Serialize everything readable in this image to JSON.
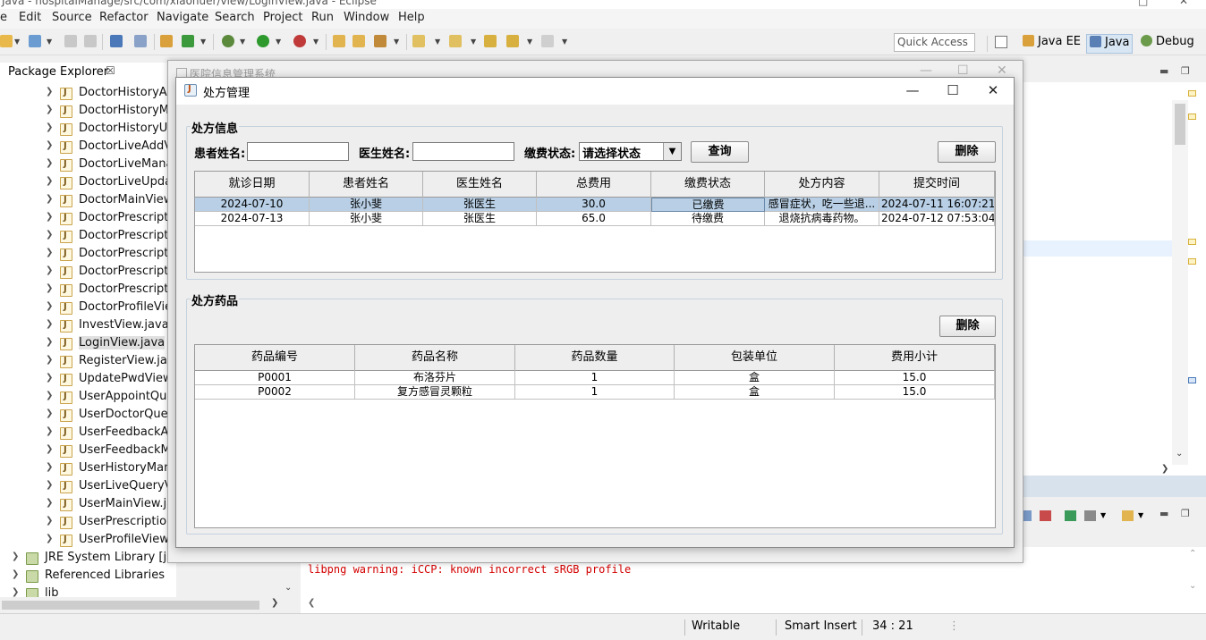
{
  "eclipse": {
    "window_title": "Java - hospitalManage/src/com/xiaohuer/view/LoginView.java - Eclipse",
    "menu": [
      "e",
      "Edit",
      "Source",
      "Refactor",
      "Navigate",
      "Search",
      "Project",
      "Run",
      "Window",
      "Help"
    ],
    "quick_access_placeholder": "Quick Access",
    "perspectives": [
      {
        "label": "Java EE"
      },
      {
        "label": "Java"
      },
      {
        "label": "Debug"
      }
    ],
    "package_explorer": {
      "tab_label": "Package Explorer",
      "tab_close": "☒",
      "files": [
        "DoctorHistoryAdd",
        "DoctorHistoryMa",
        "DoctorHistoryUpc",
        "DoctorLiveAddVie",
        "DoctorLiveManag",
        "DoctorLiveUpdate",
        "DoctorMainView.j",
        "DoctorPrescriptio",
        "DoctorPrescriptio",
        "DoctorPrescriptio",
        "DoctorPrescriptio",
        "DoctorPrescriptio",
        "DoctorProfileView",
        "InvestView.java",
        "LoginView.java",
        "RegisterView.java",
        "UpdatePwdView.ja",
        "UserAppointQuer",
        "UserDoctorQuery",
        "UserFeedbackAd",
        "UserFeedbackMa",
        "UserHistoryMana",
        "UserLiveQueryVie",
        "UserMainView.jav",
        "UserPrescriptionC",
        "UserProfileView.ja"
      ],
      "selected_index": 14,
      "roots": [
        "JRE System Library [jre1",
        "Referenced Libraries",
        "lib"
      ]
    },
    "console_text": "libpng warning: iCCP: known incorrect sRGB profile",
    "status": {
      "writable": "Writable",
      "insert_mode": "Smart Insert",
      "position": "34 : 21"
    }
  },
  "bg_dialog": {
    "title": "医院信息管理系统"
  },
  "dialog": {
    "title": "处方管理",
    "prescription": {
      "group_title": "处方信息",
      "patient_label": "患者姓名:",
      "patient_value": "",
      "doctor_label": "医生姓名:",
      "doctor_value": "",
      "status_label": "缴费状态:",
      "status_selected": "请选择状态",
      "query_button": "查询",
      "delete_button": "删除",
      "columns": [
        "就诊日期",
        "患者姓名",
        "医生姓名",
        "总费用",
        "缴费状态",
        "处方内容",
        "提交时间"
      ],
      "rows": [
        [
          "2024-07-10",
          "张小斐",
          "张医生",
          "30.0",
          "已缴费",
          "感冒症状，吃一些退...",
          "2024-07-11 16:07:21"
        ],
        [
          "2024-07-13",
          "张小斐",
          "张医生",
          "65.0",
          "待缴费",
          "退烧抗病毒药物。",
          "2024-07-12 07:53:04"
        ]
      ],
      "selected_row": 0
    },
    "drugs": {
      "group_title": "处方药品",
      "delete_button": "删除",
      "columns": [
        "药品编号",
        "药品名称",
        "药品数量",
        "包装单位",
        "费用小计"
      ],
      "rows": [
        [
          "P0001",
          "布洛芬片",
          "1",
          "盒",
          "15.0"
        ],
        [
          "P0002",
          "复方感冒灵颗粒",
          "1",
          "盒",
          "15.0"
        ]
      ]
    }
  }
}
